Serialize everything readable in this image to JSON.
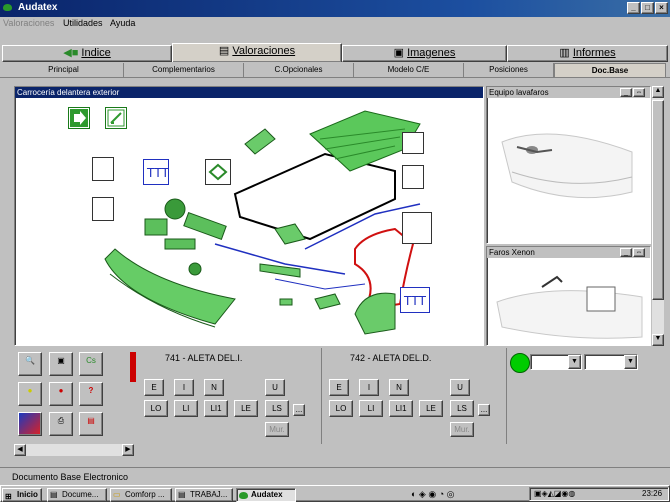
{
  "window": {
    "title": "Audatex",
    "buttons": [
      "_",
      "□",
      "×"
    ]
  },
  "menu": {
    "items": [
      "Valoraciones",
      "Utilidades",
      "Ayuda"
    ]
  },
  "main_tabs": [
    {
      "label": "Indice",
      "icon": "index-icon"
    },
    {
      "label": "Valoraciones",
      "icon": "valuations-icon",
      "active": true
    },
    {
      "label": "Imagenes",
      "icon": "images-icon"
    },
    {
      "label": "Informes",
      "icon": "reports-icon"
    }
  ],
  "sub_tabs": [
    "Principal",
    "Complementarios",
    "C.Opcionales",
    "Modelo C/E",
    "Posiciones",
    "Doc.Base"
  ],
  "diagram_panel": {
    "title": "Carrocería delantera exterior"
  },
  "side_panels": [
    {
      "title": "Equipo lavafaros"
    },
    {
      "title": "Faros Xenon"
    }
  ],
  "part_left": {
    "title": "741 - ALETA DEL.I.",
    "row1": [
      "E",
      "I",
      "N",
      "U"
    ],
    "row2": [
      "LO",
      "LI",
      "LI1",
      "LE",
      "LS",
      "..."
    ],
    "mur": "Mur."
  },
  "part_right": {
    "title": "742 - ALETA DEL.D.",
    "row1": [
      "E",
      "I",
      "N",
      "U"
    ],
    "row2": [
      "LO",
      "LI",
      "LI1",
      "LE",
      "LS",
      "..."
    ],
    "mur": "Mur."
  },
  "status": {
    "text": "Documento Base Electronico"
  },
  "taskbar": {
    "start": "Inicio",
    "tasks": [
      "Docume...",
      "Comforp ...",
      "TRABAJ...",
      "Audatex"
    ],
    "clock": "23:26"
  },
  "colors": {
    "title_start": "#0a246a",
    "part_green": "#2f9a2f",
    "part_red": "#d01010",
    "status_green": "#00cc00"
  }
}
